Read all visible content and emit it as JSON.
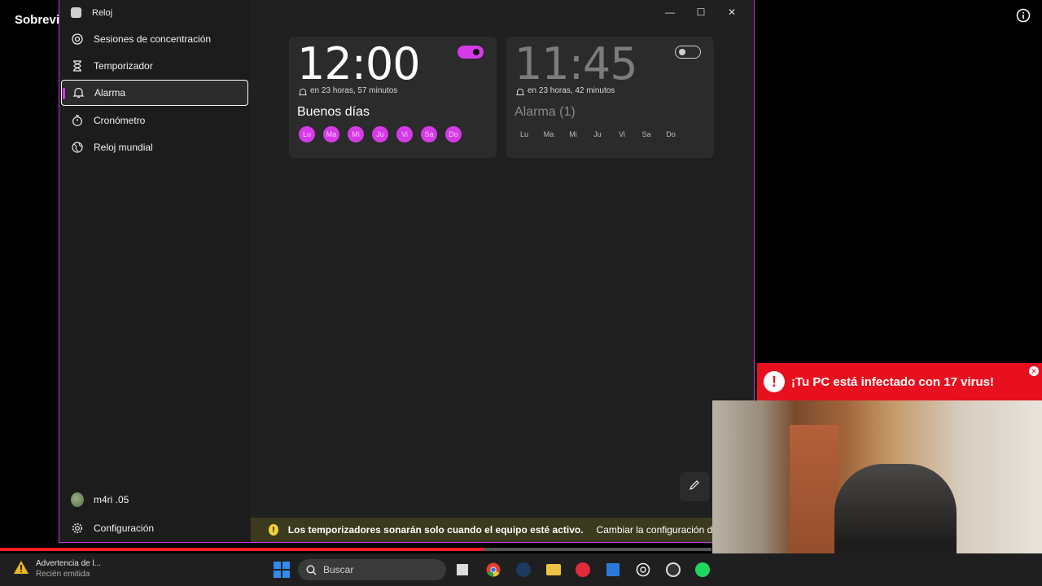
{
  "background": {
    "video_title": "Sobrevi"
  },
  "window": {
    "title": "Reloj",
    "controls": {
      "minimize": "—",
      "maximize": "☐",
      "close": "✕"
    }
  },
  "sidebar": {
    "items": [
      {
        "label": "Sesiones de concentración",
        "icon": "focus-icon"
      },
      {
        "label": "Temporizador",
        "icon": "hourglass-icon"
      },
      {
        "label": "Alarma",
        "icon": "bell-icon",
        "active": true
      },
      {
        "label": "Cronómetro",
        "icon": "stopwatch-icon"
      },
      {
        "label": "Reloj mundial",
        "icon": "globe-icon"
      }
    ],
    "user": "m4ri .05",
    "settings": "Configuración"
  },
  "alarms": [
    {
      "time": "12:00",
      "remaining": "en 23 horas, 57 minutos",
      "name": "Buenos días",
      "enabled": true,
      "days": [
        "Lu",
        "Ma",
        "Mi",
        "Ju",
        "Vi",
        "Sa",
        "Do"
      ],
      "days_active": true
    },
    {
      "time": "11:45",
      "remaining": "en 23 horas, 42 minutos",
      "name": "Alarma (1)",
      "enabled": false,
      "days": [
        "Lu",
        "Ma",
        "Mi",
        "Ju",
        "Vi",
        "Sa",
        "Do"
      ],
      "days_active": false
    }
  ],
  "infobar": {
    "message": "Los temporizadores sonarán solo cuando el equipo esté activo.",
    "link": "Cambiar la configuración de energía"
  },
  "virus_banner": {
    "text": "¡Tu PC está infectado con 17 virus!",
    "color": "#e8101e"
  },
  "video_progress": 0.68,
  "taskbar": {
    "notification_title": "Advertencia de l...",
    "notification_sub": "Recién emitida",
    "search_placeholder": "Buscar",
    "apps": [
      "task-view-icon",
      "chrome-icon",
      "steam-icon",
      "file-explorer-icon",
      "pinterest-icon",
      "store-icon",
      "chatgpt-icon",
      "app-icon",
      "spotify-icon"
    ]
  },
  "accent": "#d63ae8"
}
